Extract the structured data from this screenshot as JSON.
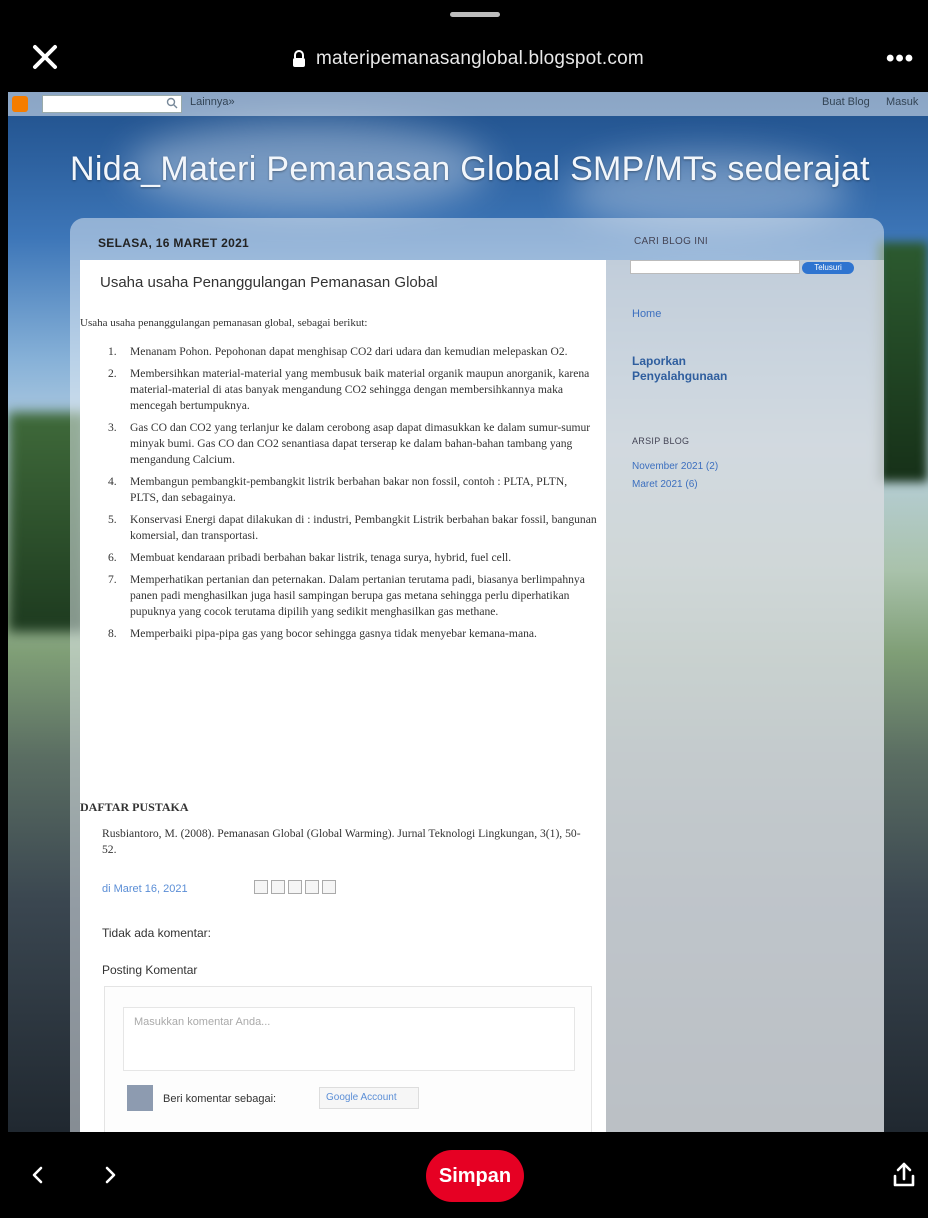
{
  "browser": {
    "url": "materipemanasanglobal.blogspot.com",
    "more_label": "•••",
    "save_label": "Simpan"
  },
  "navbar": {
    "next_label": "Lainnya»",
    "create_label": "Buat Blog",
    "signin_label": "Masuk"
  },
  "blog": {
    "title": "Nida_Materi Pemanasan Global SMP/MTs sederajat",
    "date": "SELASA, 16 MARET 2021",
    "post_title": "Usaha usaha Penanggulangan Pemanasan Global",
    "intro": "Usaha usaha penanggulangan pemanasan global, sebagai berikut:",
    "items": [
      {
        "num": "1.",
        "text": "Menanam Pohon. Pepohonan dapat menghisap CO2 dari udara dan kemudian melepaskan O2."
      },
      {
        "num": "2.",
        "text": "Membersihkan material-material yang membusuk baik material organik maupun anorganik, karena material-material di atas banyak mengandung CO2 sehingga dengan membersihkannya maka mencegah bertumpuknya."
      },
      {
        "num": "3.",
        "text": "Gas CO dan CO2 yang terlanjur ke dalam cerobong asap dapat dimasukkan ke dalam sumur-sumur minyak bumi. Gas CO dan CO2 senantiasa dapat terserap ke dalam bahan-bahan tambang yang mengandung Calcium."
      },
      {
        "num": "4.",
        "text": "Membangun pembangkit-pembangkit listrik berbahan bakar non fossil, contoh : PLTA, PLTN, PLTS, dan sebagainya."
      },
      {
        "num": "5.",
        "text": "Konservasi Energi dapat dilakukan di : industri, Pembangkit Listrik berbahan bakar fossil, bangunan komersial, dan transportasi."
      },
      {
        "num": "6.",
        "text": "Membuat kendaraan pribadi berbahan bakar listrik, tenaga surya, hybrid, fuel cell."
      },
      {
        "num": "7.",
        "text": "Memperhatikan pertanian dan peternakan. Dalam pertanian terutama padi, biasanya berlimpahnya panen padi menghasilkan juga hasil sampingan berupa gas metana sehingga perlu diperhatikan pupuknya yang cocok terutama dipilih yang sedikit menghasilkan gas methane."
      },
      {
        "num": "8.",
        "text": "Memperbaiki pipa-pipa gas yang bocor sehingga gasnya tidak menyebar kemana-mana."
      }
    ],
    "refs_heading": "DAFTAR PUSTAKA",
    "refs_text": "Rusbiantoro, M. (2008). Pemanasan Global (Global Warming). Jurnal Teknologi Lingkungan, 3(1), 50-52.",
    "post_meta": "di Maret 16, 2021",
    "no_comments": "Tidak ada komentar:",
    "post_comment": "Posting Komentar",
    "comment_placeholder": "Masukkan komentar Anda...",
    "comment_as": "Beri komentar sebagai:",
    "account_label": "Google Account"
  },
  "sidebar": {
    "search_title": "CARI BLOG INI",
    "search_button": "Telusuri",
    "home": "Home",
    "laporan": "Laporkan Penyalahgunaan",
    "archive_title": "ARSIP BLOG",
    "archive": [
      "November 2021 (2)",
      "Maret 2021 (6)"
    ]
  }
}
